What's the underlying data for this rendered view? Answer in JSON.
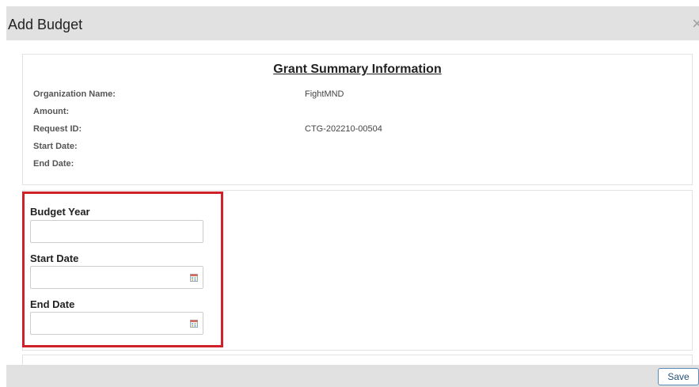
{
  "modal": {
    "title": "Add Budget",
    "close_icon": "close-icon",
    "close_glyph": "×"
  },
  "summary": {
    "title": "Grant Summary Information",
    "rows": [
      {
        "label": "Organization Name:",
        "value": "FightMND"
      },
      {
        "label": "Amount:",
        "value": ""
      },
      {
        "label": "Request ID:",
        "value": "CTG-202210-00504"
      },
      {
        "label": "Start Date:",
        "value": ""
      },
      {
        "label": "End Date:",
        "value": ""
      }
    ]
  },
  "budget_form": {
    "budget_year": {
      "label": "Budget Year",
      "value": ""
    },
    "start_date": {
      "label": "Start Date",
      "value": "",
      "icon": "calendar-icon"
    },
    "end_date": {
      "label": "End Date",
      "value": "",
      "icon": "calendar-icon"
    }
  },
  "highlight_color": "#d0202a",
  "footer": {
    "save_label": "Save"
  }
}
